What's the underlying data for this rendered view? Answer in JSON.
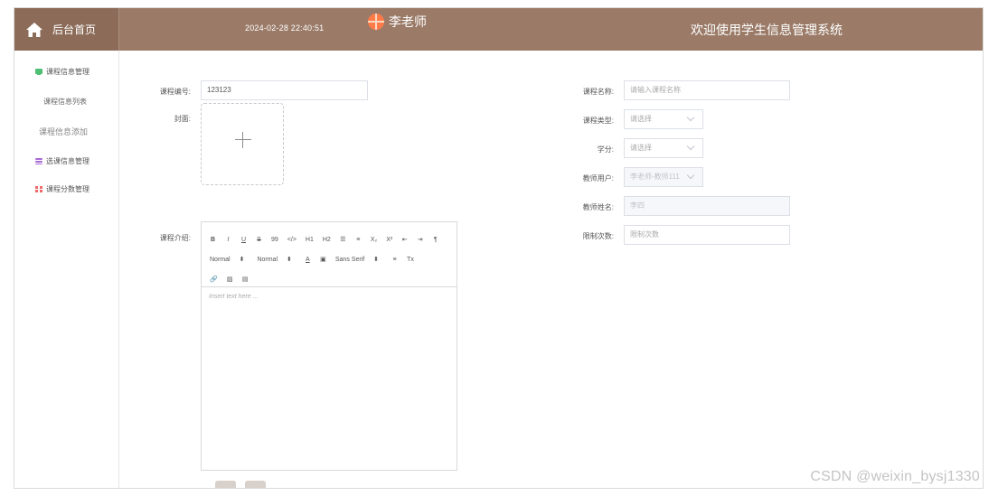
{
  "header": {
    "home_label": "后台首页",
    "datetime": "2024-02-28 22:40:51",
    "user_name": "李老师",
    "welcome_text": "欢迎使用学生信息管理系统",
    "colors": {
      "header_bg": "#9b7b68",
      "home_bg": "#8c6c59",
      "avatar": "#ff7b48"
    },
    "icons": {
      "home": "home-icon",
      "avatar": "avatar-icon"
    }
  },
  "sidebar": {
    "groups": [
      {
        "label": "课程信息管理",
        "icon": "course-info-icon",
        "color": "#4fbf73"
      },
      {
        "label": "选课信息管理",
        "icon": "course-selection-icon",
        "color": "#a86ad5"
      },
      {
        "label": "课程分数管理",
        "icon": "course-score-icon",
        "color": "#ef6a6a"
      }
    ],
    "subitems": [
      {
        "label": "课程信息列表"
      },
      {
        "label": "课程信息添加"
      }
    ]
  },
  "form": {
    "course_no": {
      "label": "课程编号:",
      "value": "123123"
    },
    "cover": {
      "label": "封面:"
    },
    "course_intro": {
      "label": "课程介绍:"
    },
    "course_name": {
      "label": "课程名称:",
      "placeholder": "请输入课程名称"
    },
    "course_type": {
      "label": "课程类型:",
      "placeholder": "请选择"
    },
    "credit": {
      "label": "学分:",
      "placeholder": "请选择"
    },
    "teacher_user": {
      "label": "教师用户:",
      "value": "李老师-教师111"
    },
    "teacher_name": {
      "label": "教师姓名:",
      "value": "李四"
    },
    "limit_count": {
      "label": "限制次数:",
      "placeholder": "限制次数"
    }
  },
  "editor": {
    "toolbar_row1": [
      "B",
      "I",
      "U",
      "S",
      "99",
      "</>",
      "H1",
      "H2",
      "☰",
      "≡",
      "X₂",
      "X²",
      "⇤",
      "⇥",
      "¶"
    ],
    "toolbar_row2": [
      {
        "type": "select",
        "value": "Normal"
      },
      {
        "type": "select",
        "value": "Normal"
      },
      {
        "type": "button",
        "value": "A"
      },
      {
        "type": "button",
        "value": "▣"
      },
      {
        "type": "select",
        "value": "Sans Serif"
      },
      {
        "type": "button",
        "value": "≡"
      },
      {
        "type": "button",
        "value": "Tx"
      }
    ],
    "toolbar_row3": [
      "🔗",
      "▨",
      "▤"
    ],
    "placeholder": "Insert text here ..."
  },
  "watermark": "CSDN @weixin_bysj1330"
}
